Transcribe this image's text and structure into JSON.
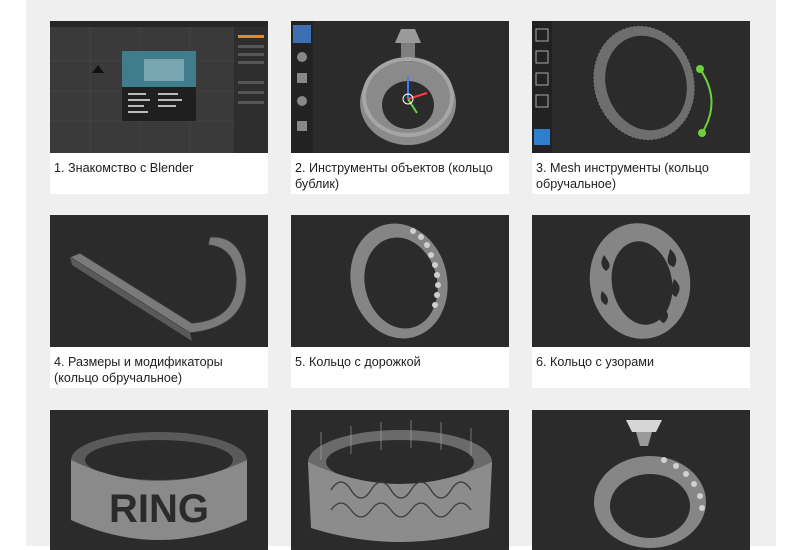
{
  "lessons": [
    {
      "title": "1. Знакомство с Blender",
      "thumb": "blender-interface-icon"
    },
    {
      "title": "2. Инструменты объектов (кольцо бублик)",
      "thumb": "torus-ring-icon"
    },
    {
      "title": "3. Mesh инструменты (кольцо обручальное)",
      "thumb": "mesh-band-ring-icon"
    },
    {
      "title": "4. Размеры и модификаторы (кольцо обручальное)",
      "thumb": "bent-strip-icon"
    },
    {
      "title": "5. Кольцо с дорожкой",
      "thumb": "eternity-ring-icon"
    },
    {
      "title": "6. Кольцо с узорами",
      "thumb": "pattern-ring-icon"
    },
    {
      "title": "",
      "thumb": "lettered-ring-icon",
      "lettering": "RING"
    },
    {
      "title": "",
      "thumb": "ornate-ring-icon"
    },
    {
      "title": "",
      "thumb": "solitaire-ring-icon"
    }
  ],
  "colors": {
    "thumb_bg": "#2b2b2b",
    "page_bg": "#efefef",
    "card_bg": "#ffffff"
  }
}
